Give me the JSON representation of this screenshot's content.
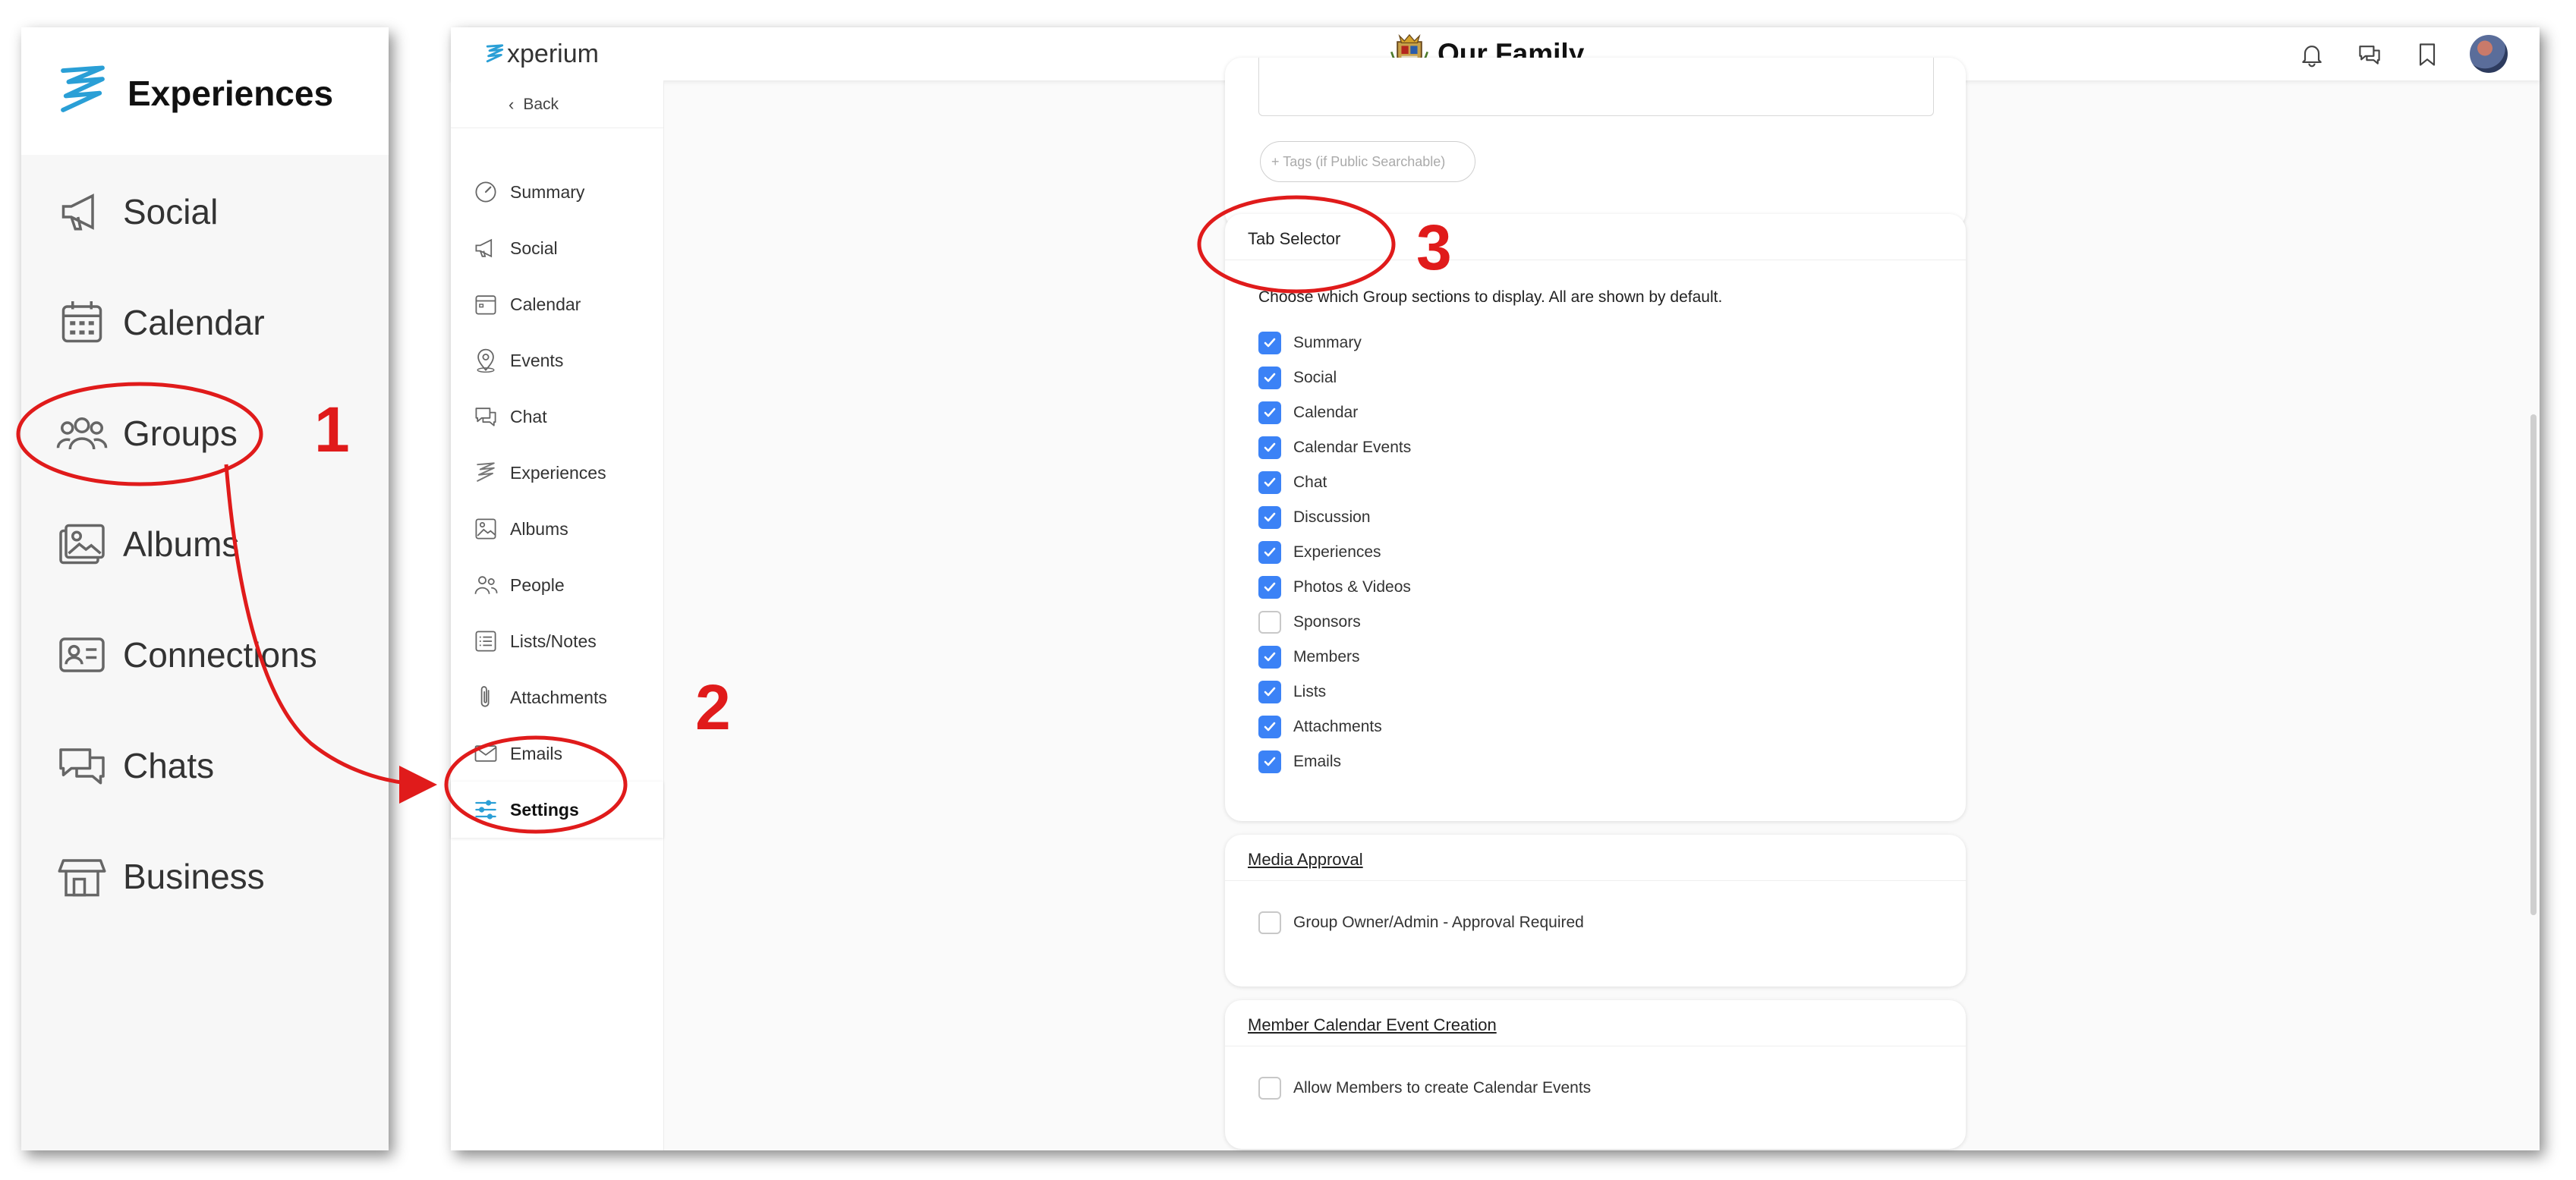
{
  "left_sidebar": {
    "brand": "Experiences",
    "items": [
      {
        "label": "Social",
        "icon": "megaphone-icon"
      },
      {
        "label": "Calendar",
        "icon": "calendar-icon"
      },
      {
        "label": "Groups",
        "icon": "people-icon"
      },
      {
        "label": "Albums",
        "icon": "album-icon"
      },
      {
        "label": "Connections",
        "icon": "contact-card-icon"
      },
      {
        "label": "Chats",
        "icon": "chat-bubbles-icon"
      },
      {
        "label": "Business",
        "icon": "storefront-icon"
      }
    ]
  },
  "header": {
    "logo_text": "xperium",
    "group_name": "Our Family",
    "icons": [
      "bell-icon",
      "chat-icon",
      "bookmark-icon",
      "avatar"
    ]
  },
  "group_sidebar": {
    "back_label": "Back",
    "items": [
      {
        "label": "Summary",
        "icon": "gauge-icon"
      },
      {
        "label": "Social",
        "icon": "megaphone-icon"
      },
      {
        "label": "Calendar",
        "icon": "calendar-icon"
      },
      {
        "label": "Events",
        "icon": "location-pin-icon"
      },
      {
        "label": "Chat",
        "icon": "chat-icon"
      },
      {
        "label": "Experiences",
        "icon": "experiences-logo-icon"
      },
      {
        "label": "Albums",
        "icon": "album-icon"
      },
      {
        "label": "People",
        "icon": "people-icon"
      },
      {
        "label": "Lists/Notes",
        "icon": "list-icon"
      },
      {
        "label": "Attachments",
        "icon": "paperclip-icon"
      },
      {
        "label": "Emails",
        "icon": "envelope-icon"
      },
      {
        "label": "Settings",
        "icon": "sliders-icon",
        "active": true
      }
    ]
  },
  "tags_input": {
    "placeholder": "+ Tags (if Public Searchable)"
  },
  "tab_selector": {
    "title": "Tab Selector",
    "description": "Choose which Group sections to display. All are shown by default.",
    "options": [
      {
        "label": "Summary",
        "checked": true
      },
      {
        "label": "Social",
        "checked": true
      },
      {
        "label": "Calendar",
        "checked": true
      },
      {
        "label": "Calendar Events",
        "checked": true
      },
      {
        "label": "Chat",
        "checked": true
      },
      {
        "label": "Discussion",
        "checked": true
      },
      {
        "label": "Experiences",
        "checked": true
      },
      {
        "label": "Photos & Videos",
        "checked": true
      },
      {
        "label": "Sponsors",
        "checked": false
      },
      {
        "label": "Members",
        "checked": true
      },
      {
        "label": "Lists",
        "checked": true
      },
      {
        "label": "Attachments",
        "checked": true
      },
      {
        "label": "Emails",
        "checked": true
      }
    ]
  },
  "media_approval": {
    "title": "Media Approval",
    "option": {
      "label": "Group Owner/Admin - Approval Required",
      "checked": false
    }
  },
  "member_calendar": {
    "title": "Member Calendar Event Creation",
    "option": {
      "label": "Allow Members to create Calendar Events",
      "checked": false
    }
  },
  "annotations": {
    "step1": "1",
    "step2": "2",
    "step3": "3"
  },
  "colors": {
    "accent": "#3b82f6",
    "annotation_red": "#e01b1b",
    "brand_blue": "#2a9fd6"
  }
}
